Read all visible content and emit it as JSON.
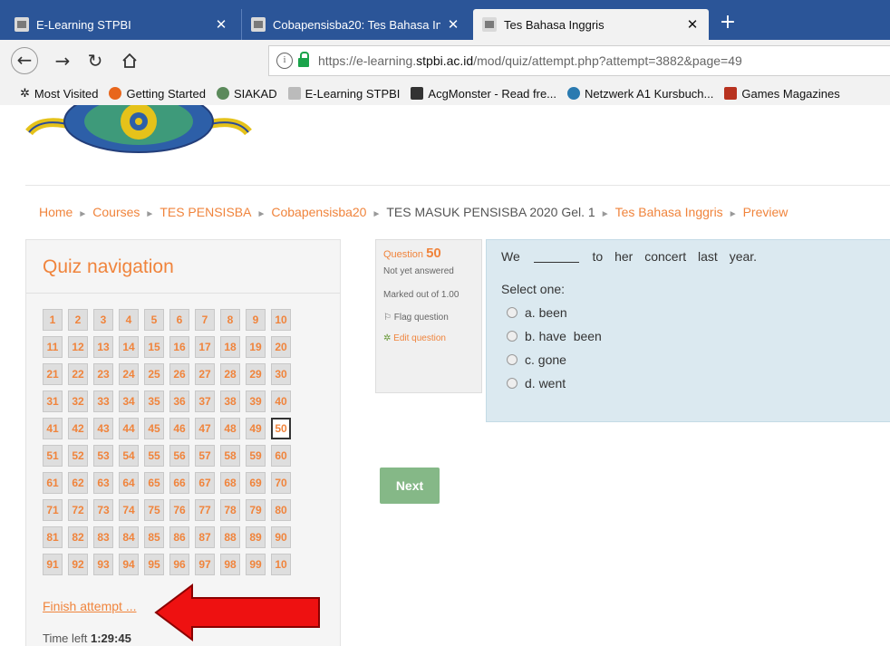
{
  "browser": {
    "tabs": [
      {
        "title": "E-Learning STPBI",
        "close": "✕"
      },
      {
        "title": "Cobapensisba20: Tes Bahasa Inggris",
        "close": "✕"
      },
      {
        "title": "Tes Bahasa Inggris",
        "close": "✕"
      }
    ],
    "new_tab": "+",
    "url": {
      "prefix": "https://e-learning.",
      "domain": "stpbi.ac.id",
      "path": "/mod/quiz/attempt.php?attempt=3882&page=49"
    },
    "bookmarks": [
      {
        "label": "Most Visited",
        "icon": "gear-icon"
      },
      {
        "label": "Getting Started",
        "icon": "firefox-icon"
      },
      {
        "label": "SIAKAD",
        "icon": "globe-icon"
      },
      {
        "label": "E-Learning STPBI",
        "icon": "page-icon"
      },
      {
        "label": "AcgMonster - Read fre...",
        "icon": "acg-icon"
      },
      {
        "label": "Netzwerk A1 Kursbuch...",
        "icon": "netzwerk-icon"
      },
      {
        "label": "Games Magazines",
        "icon": "magazine-icon"
      }
    ]
  },
  "breadcrumb": {
    "home": "Home",
    "courses": "Courses",
    "category": "TES PENSISBA",
    "course": "Cobapensisba20",
    "section": "TES MASUK PENSISBA 2020 Gel. 1",
    "quiz": "Tes Bahasa Inggris",
    "current": "Preview",
    "sep": "►"
  },
  "quiz_nav": {
    "title": "Quiz navigation",
    "buttons": [
      "1",
      "2",
      "3",
      "4",
      "5",
      "6",
      "7",
      "8",
      "9",
      "10",
      "11",
      "12",
      "13",
      "14",
      "15",
      "16",
      "17",
      "18",
      "19",
      "20",
      "21",
      "22",
      "23",
      "24",
      "25",
      "26",
      "27",
      "28",
      "29",
      "30",
      "31",
      "32",
      "33",
      "34",
      "35",
      "36",
      "37",
      "38",
      "39",
      "40",
      "41",
      "42",
      "43",
      "44",
      "45",
      "46",
      "47",
      "48",
      "49",
      "50",
      "51",
      "52",
      "53",
      "54",
      "55",
      "56",
      "57",
      "58",
      "59",
      "60",
      "61",
      "62",
      "63",
      "64",
      "65",
      "66",
      "67",
      "68",
      "69",
      "70",
      "71",
      "72",
      "73",
      "74",
      "75",
      "76",
      "77",
      "78",
      "79",
      "80",
      "81",
      "82",
      "83",
      "84",
      "85",
      "86",
      "87",
      "88",
      "89",
      "90",
      "91",
      "92",
      "93",
      "94",
      "95",
      "96",
      "97",
      "98",
      "99",
      "10"
    ],
    "current": "50",
    "finish_label": "Finish attempt ...",
    "time_label": "Time left",
    "time_value": "1:29:45"
  },
  "question_info": {
    "label": "Question",
    "number": "50",
    "state": "Not yet answered",
    "grade": "Marked out of 1.00",
    "flag": "Flag question",
    "edit": "Edit question"
  },
  "question": {
    "text_before": "We",
    "text_after": "to her concert last year.",
    "prompt": "Select one:",
    "options": [
      "a. been",
      "b. have  been",
      "c. gone",
      "d. went"
    ]
  },
  "next_label": "Next",
  "colors": {
    "accent": "#f0843c",
    "tabbar": "#2b5598",
    "question_bg": "#dbe9f0",
    "next_button": "#85b887",
    "annotation_arrow": "#ee1111"
  }
}
